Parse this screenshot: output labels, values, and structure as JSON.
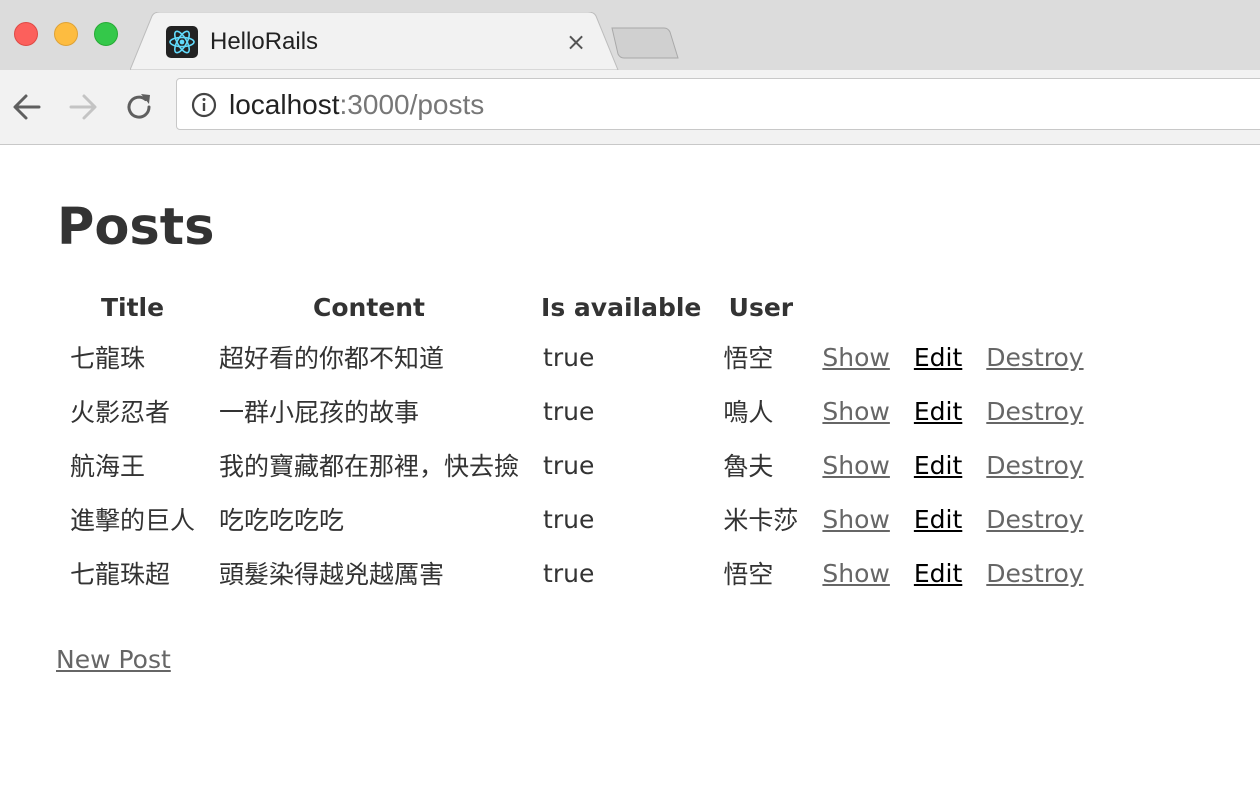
{
  "browser": {
    "tab": {
      "title": "HelloRails",
      "close_glyph": "×",
      "favicon": "react-atom-icon"
    },
    "address": {
      "host": "localhost",
      "rest": ":3000/posts"
    }
  },
  "page": {
    "title": "Posts",
    "columns": [
      "Title",
      "Content",
      "Is available",
      "User",
      "",
      "",
      ""
    ],
    "rows": [
      {
        "title": "七龍珠",
        "content": "超好看的你都不知道",
        "available": "true",
        "user": "悟空",
        "show": "Show",
        "edit": "Edit",
        "destroy": "Destroy"
      },
      {
        "title": "火影忍者",
        "content": "一群小屁孩的故事",
        "available": "true",
        "user": "鳴人",
        "show": "Show",
        "edit": "Edit",
        "destroy": "Destroy"
      },
      {
        "title": "航海王",
        "content": "我的寶藏都在那裡，快去撿",
        "available": "true",
        "user": "魯夫",
        "show": "Show",
        "edit": "Edit",
        "destroy": "Destroy"
      },
      {
        "title": "進擊的巨人",
        "content": "吃吃吃吃吃",
        "available": "true",
        "user": "米卡莎",
        "show": "Show",
        "edit": "Edit",
        "destroy": "Destroy"
      },
      {
        "title": "七龍珠超",
        "content": "頭髮染得越兇越厲害",
        "available": "true",
        "user": "悟空",
        "show": "Show",
        "edit": "Edit",
        "destroy": "Destroy"
      }
    ],
    "new_post_label": "New Post"
  },
  "colors": {
    "heading": "#333333",
    "link_visited": "#666666",
    "link_edit": "#000000"
  }
}
